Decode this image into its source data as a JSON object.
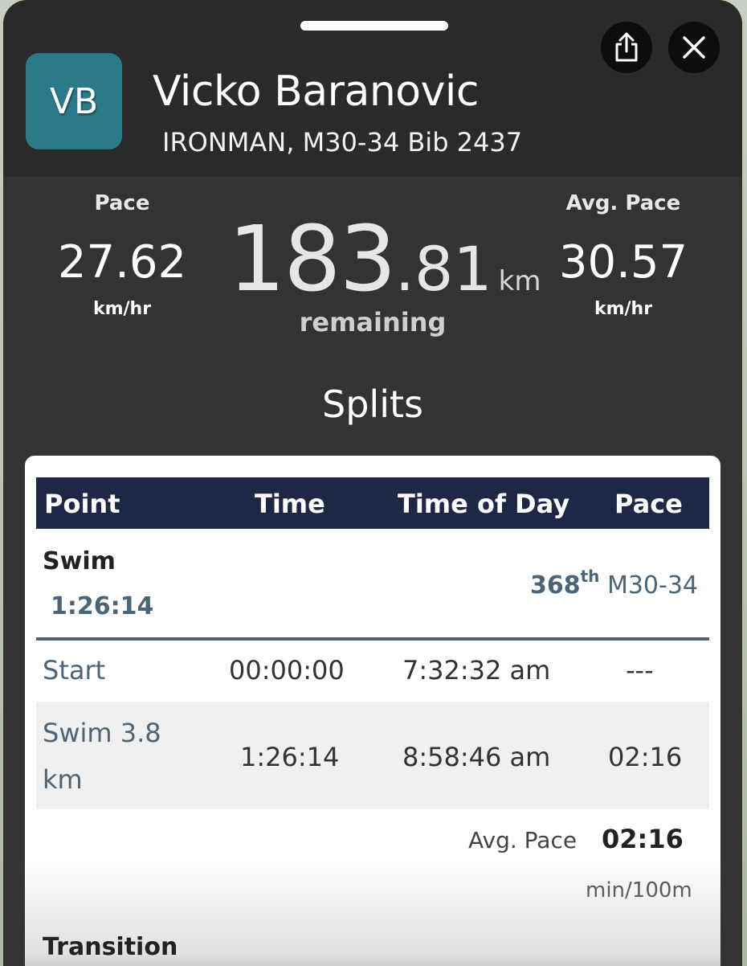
{
  "header": {
    "avatar_initials": "VB",
    "name": "Vicko Baranovic",
    "subtitle": "IRONMAN, M30-34 Bib 2437",
    "share_icon": "share-icon",
    "close_icon": "close-icon"
  },
  "stats": {
    "pace_label": "Pace",
    "pace_value": "27.62",
    "pace_unit": "km/hr",
    "remaining_int": "183",
    "remaining_dec": ".81",
    "remaining_unit": "km",
    "remaining_label": "remaining",
    "avg_pace_label": "Avg. Pace",
    "avg_pace_value": "30.57",
    "avg_pace_unit": "km/hr"
  },
  "splits": {
    "title": "Splits",
    "columns": [
      "Point",
      "Time",
      "Time of Day",
      "Pace"
    ],
    "segment": {
      "name": "Swim",
      "time": "1:26:14",
      "rank_number": "368",
      "rank_suffix": "th",
      "rank_division": "M30-34"
    },
    "rows": [
      {
        "point": "Start",
        "time": "00:00:00",
        "time_of_day": "7:32:32 am",
        "pace": "---"
      },
      {
        "point_line1": "Swim 3.8",
        "point_line2": "km",
        "time": "1:26:14",
        "time_of_day": "8:58:46 am",
        "pace": "02:16"
      }
    ],
    "avg_pace_label": "Avg. Pace",
    "avg_pace_value": "02:16",
    "avg_pace_unit": "min/100m",
    "next_segment": "Transition"
  },
  "colors": {
    "sheet": "#333333",
    "header": "#2a2a2a",
    "avatar": "#2a7a8a",
    "table_header": "#1e2746",
    "accent_text": "#4a6478"
  }
}
